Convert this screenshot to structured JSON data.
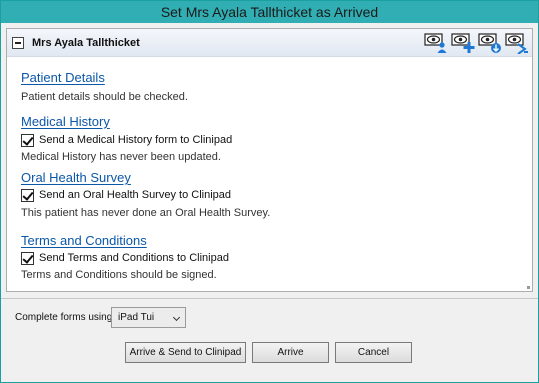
{
  "window": {
    "title": "Set Mrs Ayala Tallthicket as Arrived"
  },
  "patient": {
    "name": "Mrs Ayala Tallthicket"
  },
  "header_icons": [
    "eye-person-icon",
    "eye-plus-icon",
    "eye-download-icon",
    "eye-arrow-icon"
  ],
  "sections": {
    "patient_details": {
      "title": "Patient Details",
      "text": "Patient details should be checked."
    },
    "medical_history": {
      "title": "Medical History",
      "checkbox_label": "Send a Medical History form to Clinipad",
      "checked": true,
      "text": "Medical History has never been updated."
    },
    "oral_health": {
      "title": "Oral Health Survey",
      "checkbox_label": "Send an Oral Health Survey to Clinipad",
      "checked": true,
      "text": "This patient has never done an Oral Health Survey."
    },
    "terms": {
      "title": "Terms and Conditions",
      "checkbox_label": "Send Terms and Conditions to Clinipad",
      "checked": true,
      "text": "Terms and Conditions should be signed."
    }
  },
  "footer": {
    "complete_label": "Complete forms using",
    "device_selected": "iPad Tui",
    "arrive_send_label": "Arrive & Send to Clinipad",
    "arrive_label": "Arrive",
    "cancel_label": "Cancel"
  },
  "colors": {
    "titlebar": "#31aeb3",
    "link": "#0b57a8"
  }
}
